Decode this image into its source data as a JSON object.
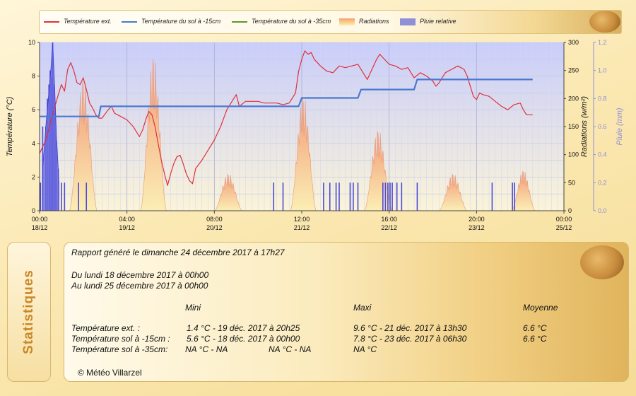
{
  "legend": [
    {
      "label": "Température ext.",
      "color": "#e0303a",
      "kind": "line"
    },
    {
      "label": "Température du sol à -15cm",
      "color": "#4a78d0",
      "kind": "line"
    },
    {
      "label": "Température du sol à -35cm",
      "color": "#5a9a2a",
      "kind": "line"
    },
    {
      "label": "Radiations",
      "color": "#f2b080",
      "kind": "area"
    },
    {
      "label": "Pluie relative",
      "color": "#8f8fd8",
      "kind": "area"
    }
  ],
  "chart_data": {
    "type": "line",
    "grid": true,
    "legend_position": "top",
    "xlim": [
      0,
      168
    ],
    "x_ticks": [
      {
        "h": 0,
        "time": "00:00",
        "date": "18/12"
      },
      {
        "h": 28,
        "time": "04:00",
        "date": "19/12"
      },
      {
        "h": 56,
        "time": "08:00",
        "date": "20/12"
      },
      {
        "h": 84,
        "time": "12:00",
        "date": "21/12"
      },
      {
        "h": 112,
        "time": "16:00",
        "date": "22/12"
      },
      {
        "h": 140,
        "time": "20:00",
        "date": "23/12"
      },
      {
        "h": 168,
        "time": "00:00",
        "date": "25/12"
      }
    ],
    "y_left": {
      "label": "Température (°C)",
      "lim": [
        0,
        10
      ],
      "ticks": [
        "0",
        "2",
        "4",
        "6",
        "8",
        "10"
      ]
    },
    "y_right1": {
      "label": "Radiations (w/m²)",
      "lim": [
        0,
        300
      ],
      "ticks": [
        "0",
        "50",
        "100",
        "150",
        "200",
        "250",
        "300"
      ]
    },
    "y_right2": {
      "label": "Pluie (mm)",
      "lim": [
        0,
        1.2
      ],
      "ticks": [
        "0.0",
        "0.2",
        "0.4",
        "0.6",
        "0.8",
        "1.0",
        "1.2"
      ]
    },
    "series": [
      {
        "name": "Température ext.",
        "axis": "left",
        "color": "#e0303a",
        "points": [
          [
            0,
            3.4
          ],
          [
            2,
            4.2
          ],
          [
            4,
            5.6
          ],
          [
            6,
            6.9
          ],
          [
            7,
            7.5
          ],
          [
            8,
            7.1
          ],
          [
            9,
            8.4
          ],
          [
            10,
            8.8
          ],
          [
            11,
            8.3
          ],
          [
            12,
            7.6
          ],
          [
            13,
            7.5
          ],
          [
            14,
            7.9
          ],
          [
            15,
            7.2
          ],
          [
            16,
            6.4
          ],
          [
            17,
            6.1
          ],
          [
            18,
            5.7
          ],
          [
            19,
            5.5
          ],
          [
            20,
            5.5
          ],
          [
            22,
            6.0
          ],
          [
            23,
            6.2
          ],
          [
            24,
            5.8
          ],
          [
            26,
            5.6
          ],
          [
            28,
            5.4
          ],
          [
            30,
            5.0
          ],
          [
            31,
            4.7
          ],
          [
            32,
            4.4
          ],
          [
            33,
            4.8
          ],
          [
            34,
            5.4
          ],
          [
            35,
            5.9
          ],
          [
            36,
            5.7
          ],
          [
            37,
            5.0
          ],
          [
            38,
            4.0
          ],
          [
            39,
            3.0
          ],
          [
            40,
            2.2
          ],
          [
            41,
            1.5
          ],
          [
            42,
            2.2
          ],
          [
            43,
            2.8
          ],
          [
            44,
            3.2
          ],
          [
            45,
            3.3
          ],
          [
            46,
            2.8
          ],
          [
            47,
            2.2
          ],
          [
            48,
            1.8
          ],
          [
            49,
            1.6
          ],
          [
            50,
            2.5
          ],
          [
            52,
            3.0
          ],
          [
            54,
            3.6
          ],
          [
            56,
            4.2
          ],
          [
            58,
            5.0
          ],
          [
            60,
            6.0
          ],
          [
            62,
            6.6
          ],
          [
            63,
            6.9
          ],
          [
            64,
            6.2
          ],
          [
            66,
            6.5
          ],
          [
            68,
            6.5
          ],
          [
            70,
            6.5
          ],
          [
            72,
            6.4
          ],
          [
            74,
            6.4
          ],
          [
            76,
            6.4
          ],
          [
            78,
            6.3
          ],
          [
            80,
            6.4
          ],
          [
            82,
            7.0
          ],
          [
            83,
            8.3
          ],
          [
            84,
            9.0
          ],
          [
            85,
            9.5
          ],
          [
            86,
            9.3
          ],
          [
            87,
            9.4
          ],
          [
            88,
            9.0
          ],
          [
            90,
            8.6
          ],
          [
            92,
            8.3
          ],
          [
            94,
            8.2
          ],
          [
            96,
            8.6
          ],
          [
            98,
            8.5
          ],
          [
            100,
            8.6
          ],
          [
            102,
            8.7
          ],
          [
            103,
            8.4
          ],
          [
            104,
            8.1
          ],
          [
            105,
            7.8
          ],
          [
            106,
            8.2
          ],
          [
            108,
            9.0
          ],
          [
            109,
            9.3
          ],
          [
            110,
            9.1
          ],
          [
            112,
            8.7
          ],
          [
            114,
            8.6
          ],
          [
            116,
            8.4
          ],
          [
            118,
            8.5
          ],
          [
            119,
            8.2
          ],
          [
            120,
            7.9
          ],
          [
            122,
            8.2
          ],
          [
            124,
            8.0
          ],
          [
            126,
            7.7
          ],
          [
            127,
            7.4
          ],
          [
            128,
            7.6
          ],
          [
            130,
            8.2
          ],
          [
            132,
            8.4
          ],
          [
            134,
            8.6
          ],
          [
            136,
            8.4
          ],
          [
            137,
            8.0
          ],
          [
            138,
            7.4
          ],
          [
            139,
            6.8
          ],
          [
            140,
            6.6
          ],
          [
            141,
            7.0
          ],
          [
            142,
            6.9
          ],
          [
            144,
            6.8
          ],
          [
            146,
            6.5
          ],
          [
            148,
            6.2
          ],
          [
            150,
            6.0
          ],
          [
            152,
            6.3
          ],
          [
            154,
            6.4
          ],
          [
            155,
            6.0
          ],
          [
            156,
            5.7
          ],
          [
            158,
            5.7
          ]
        ]
      },
      {
        "name": "Température du sol à -15cm",
        "axis": "left",
        "color": "#4a78d0",
        "points": [
          [
            0,
            5.6
          ],
          [
            19,
            5.6
          ],
          [
            19.6,
            6.2
          ],
          [
            83,
            6.2
          ],
          [
            84,
            6.7
          ],
          [
            102,
            6.7
          ],
          [
            103,
            7.2
          ],
          [
            120,
            7.2
          ],
          [
            121,
            7.8
          ],
          [
            158,
            7.8
          ]
        ]
      }
    ],
    "radiation_peaks": [
      {
        "center": 14,
        "width": 4.5,
        "peak": 195
      },
      {
        "center": 36.5,
        "width": 4.2,
        "peak": 230
      },
      {
        "center": 60.5,
        "width": 4.5,
        "peak": 55
      },
      {
        "center": 84.5,
        "width": 4.2,
        "peak": 170
      },
      {
        "center": 108.5,
        "width": 4.5,
        "peak": 120
      },
      {
        "center": 132.5,
        "width": 4.5,
        "peak": 55
      },
      {
        "center": 155,
        "width": 3.8,
        "peak": 60
      }
    ],
    "rain": [
      {
        "h": 0.3,
        "v": 0.2
      },
      {
        "h": 1.0,
        "v": 0.6
      },
      {
        "h": 2.0,
        "v": 0.6
      },
      {
        "h": 2.5,
        "v": 0.8
      },
      {
        "h": 3.0,
        "v": 0.9
      },
      {
        "h": 3.4,
        "v": 1.0
      },
      {
        "h": 3.8,
        "v": 0.95
      },
      {
        "h": 4.2,
        "v": 1.2
      },
      {
        "h": 4.6,
        "v": 0.9
      },
      {
        "h": 5.0,
        "v": 0.7
      },
      {
        "h": 5.4,
        "v": 0.5
      },
      {
        "h": 6.0,
        "v": 0.3
      },
      {
        "h": 7.0,
        "v": 0.2
      },
      {
        "h": 8.0,
        "v": 0.2
      },
      {
        "h": 12.5,
        "v": 0.2
      },
      {
        "h": 15.0,
        "v": 0.2
      },
      {
        "h": 75.0,
        "v": 0.2
      },
      {
        "h": 78.0,
        "v": 0.2
      },
      {
        "h": 91.0,
        "v": 0.2
      },
      {
        "h": 93.0,
        "v": 0.2
      },
      {
        "h": 95.0,
        "v": 0.2
      },
      {
        "h": 96.0,
        "v": 0.2
      },
      {
        "h": 99.5,
        "v": 0.2
      },
      {
        "h": 100.5,
        "v": 0.2
      },
      {
        "h": 102.0,
        "v": 0.2
      },
      {
        "h": 110.0,
        "v": 0.2
      },
      {
        "h": 110.8,
        "v": 0.2
      },
      {
        "h": 111.6,
        "v": 0.2
      },
      {
        "h": 112.3,
        "v": 0.2
      },
      {
        "h": 113.0,
        "v": 0.2
      },
      {
        "h": 114.5,
        "v": 0.2
      },
      {
        "h": 116.0,
        "v": 0.2
      },
      {
        "h": 121.0,
        "v": 0.2
      },
      {
        "h": 145.0,
        "v": 0.2
      },
      {
        "h": 151.5,
        "v": 0.2
      },
      {
        "h": 152.2,
        "v": 0.2
      }
    ]
  },
  "stats": {
    "tab_label": "Statistiques",
    "report_line": "Rapport généré le dimanche 24 décembre 2017 à 17h27",
    "period_from": "Du lundi 18 décembre 2017 à 00h00",
    "period_to": "Au lundi 25 décembre 2017 à 00h00",
    "col_min": "Mini",
    "col_max": "Maxi",
    "col_avg": "Moyenne",
    "rows": [
      {
        "label": "Température ext. :",
        "min": "1.4 °C - 19 déc. 2017 à 20h25",
        "max": "9.6 °C - 21 déc. 2017 à 13h30",
        "avg": "6.6 °C"
      },
      {
        "label": "Température sol à -15cm :",
        "min": "5.6 °C - 18 déc. 2017 à 00h00",
        "max": "7.8 °C - 23 déc. 2017 à 06h30",
        "avg": "6.6 °C"
      }
    ],
    "row3": {
      "label": "Température sol à -35cm:",
      "min": "NA °C - NA",
      "mid": "NA °C - NA",
      "max": "NA °C"
    },
    "copyright": "© Météo Villarzel"
  }
}
